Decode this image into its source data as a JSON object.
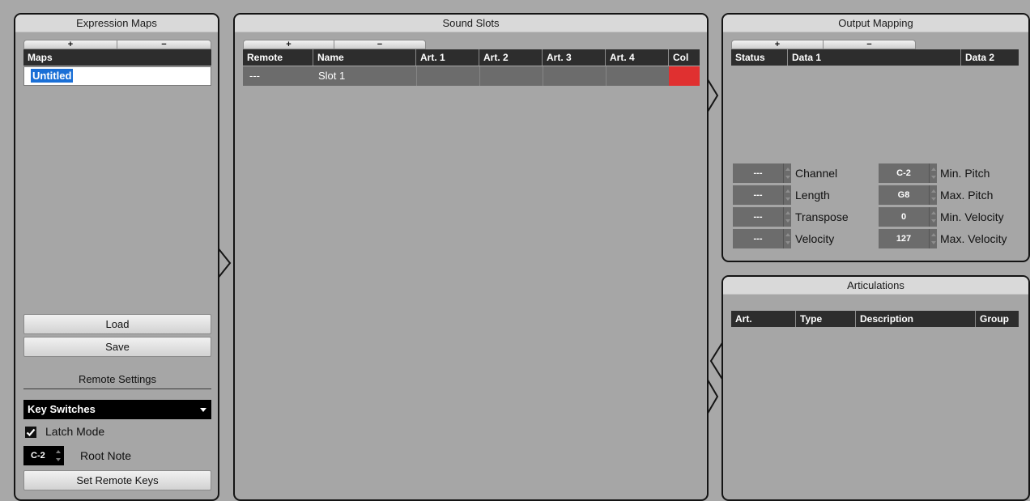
{
  "expression_maps": {
    "title": "Expression Maps",
    "add_label": "+",
    "remove_label": "−",
    "maps_header": "Maps",
    "maps": [
      "Untitled"
    ],
    "load_label": "Load",
    "save_label": "Save",
    "remote_settings_title": "Remote Settings",
    "remote_mode": "Key Switches",
    "latch_mode_label": "Latch Mode",
    "latch_mode_checked": true,
    "root_note_value": "C-2",
    "root_note_label": "Root Note",
    "set_remote_keys_label": "Set Remote Keys"
  },
  "sound_slots": {
    "title": "Sound Slots",
    "add_label": "+",
    "remove_label": "−",
    "columns": [
      "Remote",
      "Name",
      "Art. 1",
      "Art. 2",
      "Art. 3",
      "Art. 4",
      "Col"
    ],
    "rows": [
      {
        "remote": "---",
        "name": "Slot 1",
        "art1": "",
        "art2": "",
        "art3": "",
        "art4": "",
        "color": "#e03030"
      }
    ]
  },
  "output_mapping": {
    "title": "Output Mapping",
    "add_label": "+",
    "remove_label": "−",
    "columns": [
      "Status",
      "Data 1",
      "Data 2"
    ],
    "left_fields": [
      {
        "value": "---",
        "label": "Channel"
      },
      {
        "value": "---",
        "label": "Length"
      },
      {
        "value": "---",
        "label": "Transpose"
      },
      {
        "value": "---",
        "label": "Velocity"
      }
    ],
    "right_fields": [
      {
        "value": "C-2",
        "label": "Min. Pitch"
      },
      {
        "value": "G8",
        "label": "Max. Pitch"
      },
      {
        "value": "0",
        "label": "Min. Velocity"
      },
      {
        "value": "127",
        "label": "Max. Velocity"
      }
    ]
  },
  "articulations": {
    "title": "Articulations",
    "columns": [
      "Art.",
      "Type",
      "Description",
      "Group"
    ]
  },
  "colors": {
    "background": "#a8a8a8",
    "panel_border": "#141414",
    "header_bg": "#2d2d2d",
    "selected_row": "#6c6c6c",
    "slot_color": "#e03030"
  }
}
